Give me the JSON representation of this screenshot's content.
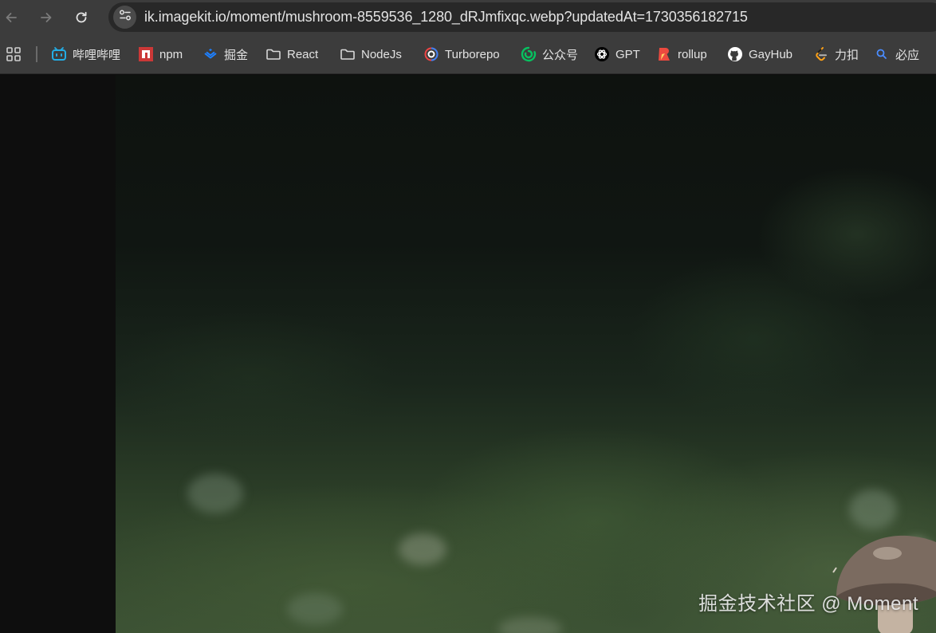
{
  "toolbar": {
    "url": "ik.imagekit.io/moment/mushroom-8559536_1280_dRJmfixqc.webp?updatedAt=1730356182715"
  },
  "bookmarks": [
    {
      "label": "哔哩哔哩",
      "icon": "bilibili-icon"
    },
    {
      "label": "npm",
      "icon": "npm-icon"
    },
    {
      "label": "掘金",
      "icon": "juejin-icon"
    },
    {
      "label": "React",
      "icon": "folder-icon"
    },
    {
      "label": "NodeJs",
      "icon": "folder-icon"
    },
    {
      "label": "Turborepo",
      "icon": "turborepo-icon"
    },
    {
      "label": "公众号",
      "icon": "wechat-icon"
    },
    {
      "label": "GPT",
      "icon": "openai-icon"
    },
    {
      "label": "rollup",
      "icon": "rollup-icon"
    },
    {
      "label": "GayHub",
      "icon": "github-icon"
    },
    {
      "label": "力扣",
      "icon": "leetcode-icon"
    },
    {
      "label": "必应",
      "icon": "bing-search-icon"
    }
  ],
  "image": {
    "watermark": "掘金技术社区 @ Moment"
  },
  "colors": {
    "toolbar_bg": "#3c3c3c",
    "omnibox_bg": "#282828",
    "page_bg": "#0e0e0e"
  }
}
